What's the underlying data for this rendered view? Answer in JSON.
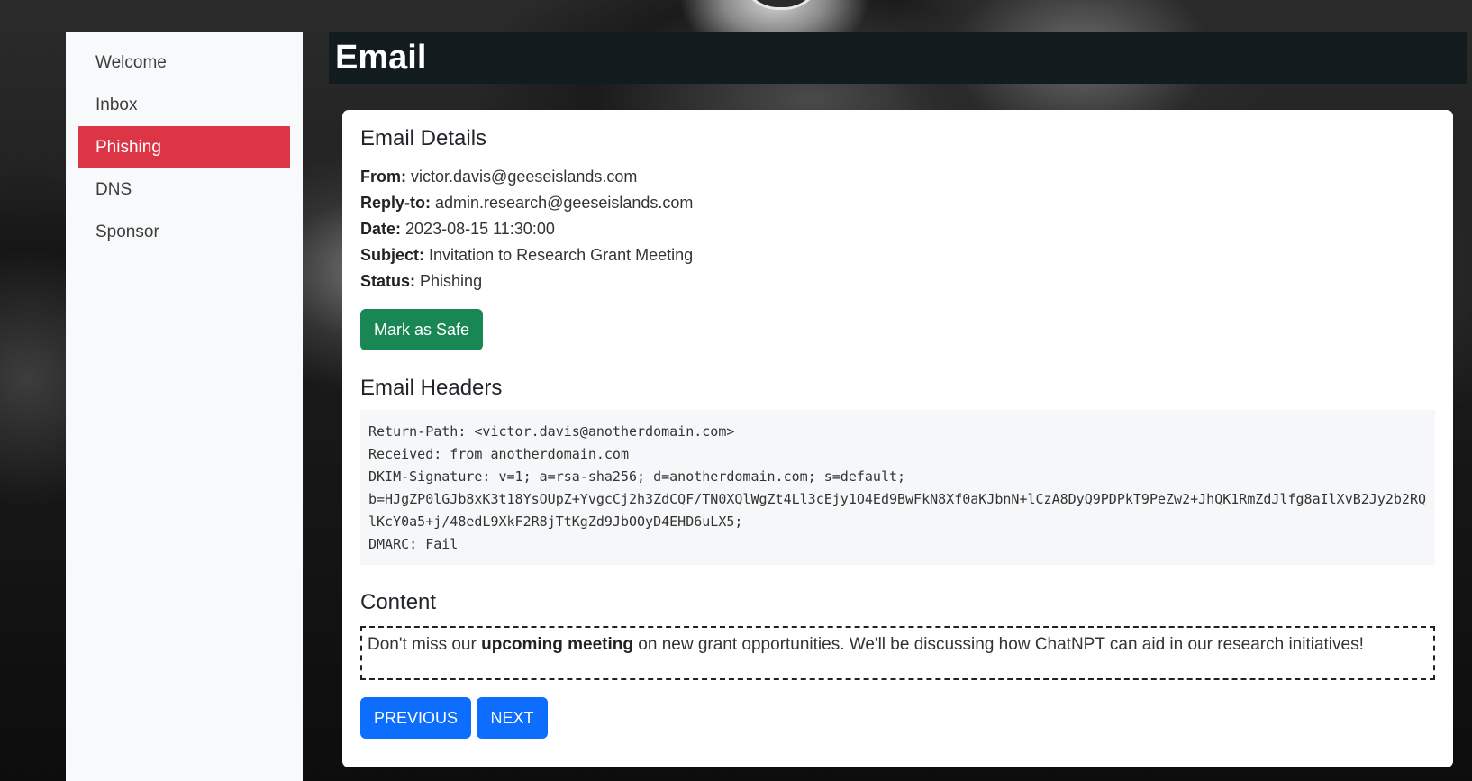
{
  "sidebar": {
    "items": [
      {
        "label": "Welcome",
        "active": false
      },
      {
        "label": "Inbox",
        "active": false
      },
      {
        "label": "Phishing",
        "active": true
      },
      {
        "label": "DNS",
        "active": false
      },
      {
        "label": "Sponsor",
        "active": false
      }
    ]
  },
  "header": {
    "title": "Email"
  },
  "details": {
    "title": "Email Details",
    "from_label": "From:",
    "from_value": "victor.davis@geeseislands.com",
    "reply_to_label": "Reply-to:",
    "reply_to_value": "admin.research@geeseislands.com",
    "date_label": "Date:",
    "date_value": "2023-08-15 11:30:00",
    "subject_label": "Subject:",
    "subject_value": "Invitation to Research Grant Meeting",
    "status_label": "Status:",
    "status_value": "Phishing",
    "mark_safe_label": "Mark as Safe"
  },
  "headers": {
    "title": "Email Headers",
    "lines": [
      "Return-Path: <victor.davis@anotherdomain.com>",
      "Received: from anotherdomain.com",
      "DKIM-Signature: v=1; a=rsa-sha256; d=anotherdomain.com; s=default;",
      "b=HJgZP0lGJb8xK3t18YsOUpZ+YvgcCj2h3ZdCQF/TN0XQlWgZt4Ll3cEjy1O4Ed9BwFkN8Xf0aKJbnN+lCzA8DyQ9PDPkT9PeZw2+JhQK1RmZdJlfg8aIlXvB2Jy2b2RQlKcY0a5+j/48edL9XkF2R8jTtKgZd9JbOOyD4EHD6uLX5;",
      "DMARC: Fail"
    ]
  },
  "content": {
    "title": "Content",
    "text_before": "Don't miss our ",
    "text_bold": "upcoming meeting",
    "text_after": " on new grant opportunities. We'll be discussing how ChatNPT can aid in our research initiatives!"
  },
  "navigation": {
    "previous_label": "PREVIOUS",
    "next_label": "NEXT"
  },
  "colors": {
    "active_nav": "#dc3545",
    "header_bg": "#121b1d",
    "success": "#198754",
    "primary": "#0d6efd"
  }
}
